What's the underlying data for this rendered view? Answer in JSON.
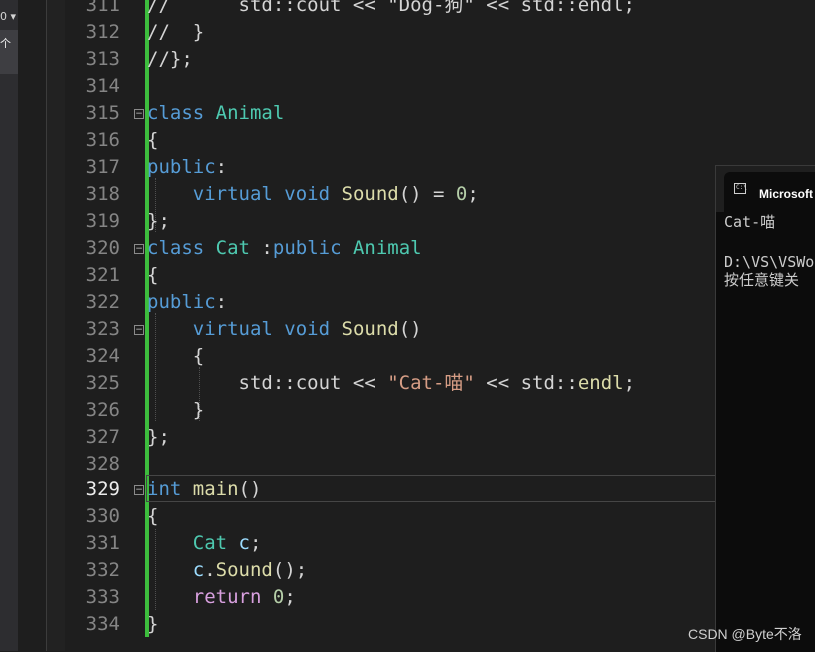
{
  "left_panel": {
    "top_glyph": "0 ▾",
    "tab_label": "个"
  },
  "editor": {
    "lines": [
      {
        "num": "311",
        "code": "//      std::cout << \"Dog-狗\" << std::endl;"
      },
      {
        "num": "312",
        "code": "//  }"
      },
      {
        "num": "313",
        "code": "//};"
      },
      {
        "num": "314",
        "code": ""
      },
      {
        "num": "315",
        "code": "class Animal"
      },
      {
        "num": "316",
        "code": "{"
      },
      {
        "num": "317",
        "code": "public:"
      },
      {
        "num": "318",
        "code": "    virtual void Sound() = 0;"
      },
      {
        "num": "319",
        "code": "};"
      },
      {
        "num": "320",
        "code": "class Cat :public Animal"
      },
      {
        "num": "321",
        "code": "{"
      },
      {
        "num": "322",
        "code": "public:"
      },
      {
        "num": "323",
        "code": "    virtual void Sound()"
      },
      {
        "num": "324",
        "code": "    {"
      },
      {
        "num": "325",
        "code": "        std::cout << \"Cat-喵\" << std::endl;"
      },
      {
        "num": "326",
        "code": "    }"
      },
      {
        "num": "327",
        "code": "};"
      },
      {
        "num": "328",
        "code": ""
      },
      {
        "num": "329",
        "code": "int main()"
      },
      {
        "num": "330",
        "code": "{"
      },
      {
        "num": "331",
        "code": "    Cat c;"
      },
      {
        "num": "332",
        "code": "    c.Sound();"
      },
      {
        "num": "333",
        "code": "    return 0;"
      },
      {
        "num": "334",
        "code": "}"
      }
    ],
    "current_line": "329"
  },
  "console": {
    "title": "Microsoft",
    "output": [
      "Cat-喵",
      "",
      "D:\\VS\\VSWo",
      "按任意键关"
    ]
  },
  "watermark": "CSDN @Byte不洛",
  "colors": {
    "keyword": "#569cd6",
    "type": "#4ec9b0",
    "function": "#dcdcaa",
    "number": "#b5cea8",
    "comment": "#57a64a",
    "string": "#d69d85",
    "control": "#d8a0df",
    "variable": "#9cdcfe",
    "change_bar": "#3dbd3d"
  }
}
